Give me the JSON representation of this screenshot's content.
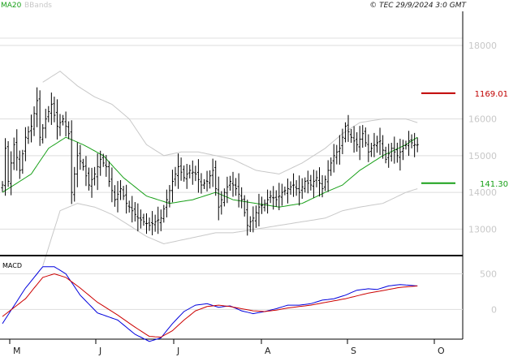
{
  "header": {
    "legend_ma": "MA20",
    "legend_bb": "BBands",
    "copyright": "© TEC 29/9/2024 3:0 GMT",
    "colors": {
      "ma": "#18a018",
      "bb": "#c8c8c8",
      "price": "#000000"
    }
  },
  "markers": {
    "resistance": {
      "label": "1169.01",
      "value": 16700,
      "color": "#c00000"
    },
    "support": {
      "label": "141.30",
      "value": 14250,
      "color": "#18a018"
    }
  },
  "macd_panel": {
    "label": "MACD"
  },
  "chart_data": [
    {
      "type": "ohlc",
      "title": "",
      "x_months": [
        "M",
        "J",
        "J",
        "A",
        "S",
        "O"
      ],
      "yticks": [
        13000,
        14000,
        15000,
        16000,
        18000
      ],
      "ylim": [
        12300,
        19000
      ],
      "n_bars": 145,
      "price_anchors": [
        [
          0,
          14200
        ],
        [
          1,
          15200
        ],
        [
          2,
          14300
        ],
        [
          4,
          15300
        ],
        [
          6,
          14600
        ],
        [
          8,
          15500
        ],
        [
          10,
          15800
        ],
        [
          12,
          16500
        ],
        [
          13,
          15500
        ],
        [
          15,
          16000
        ],
        [
          17,
          16400
        ],
        [
          19,
          15800
        ],
        [
          21,
          16000
        ],
        [
          23,
          15600
        ],
        [
          24,
          14000
        ],
        [
          26,
          15000
        ],
        [
          28,
          14700
        ],
        [
          30,
          14200
        ],
        [
          32,
          14500
        ],
        [
          34,
          14900
        ],
        [
          36,
          14700
        ],
        [
          37,
          14300
        ],
        [
          39,
          13800
        ],
        [
          41,
          14100
        ],
        [
          43,
          13700
        ],
        [
          45,
          13500
        ],
        [
          47,
          13300
        ],
        [
          49,
          13200
        ],
        [
          51,
          13100
        ],
        [
          53,
          13200
        ],
        [
          55,
          13300
        ],
        [
          57,
          13800
        ],
        [
          59,
          14300
        ],
        [
          61,
          14700
        ],
        [
          63,
          14400
        ],
        [
          65,
          14600
        ],
        [
          67,
          14500
        ],
        [
          69,
          14200
        ],
        [
          71,
          14300
        ],
        [
          73,
          14600
        ],
        [
          75,
          13600
        ],
        [
          77,
          14000
        ],
        [
          79,
          14300
        ],
        [
          81,
          14100
        ],
        [
          83,
          13800
        ],
        [
          85,
          13100
        ],
        [
          87,
          13300
        ],
        [
          89,
          13600
        ],
        [
          91,
          13700
        ],
        [
          93,
          13900
        ],
        [
          95,
          13800
        ],
        [
          97,
          14000
        ],
        [
          99,
          14100
        ],
        [
          101,
          14200
        ],
        [
          103,
          14000
        ],
        [
          105,
          14300
        ],
        [
          107,
          14200
        ],
        [
          109,
          14400
        ],
        [
          111,
          14100
        ],
        [
          113,
          14600
        ],
        [
          115,
          15000
        ],
        [
          117,
          15200
        ],
        [
          119,
          15800
        ],
        [
          121,
          15500
        ],
        [
          123,
          15300
        ],
        [
          125,
          15600
        ],
        [
          127,
          15100
        ],
        [
          129,
          15300
        ],
        [
          131,
          15400
        ],
        [
          133,
          14900
        ],
        [
          135,
          15200
        ],
        [
          137,
          15000
        ],
        [
          139,
          15200
        ],
        [
          141,
          15400
        ],
        [
          143,
          15300
        ],
        [
          144,
          15300
        ]
      ],
      "ma20_anchors": [
        [
          0,
          14000
        ],
        [
          10,
          14500
        ],
        [
          16,
          15200
        ],
        [
          22,
          15500
        ],
        [
          28,
          15300
        ],
        [
          35,
          15000
        ],
        [
          42,
          14400
        ],
        [
          50,
          13900
        ],
        [
          58,
          13700
        ],
        [
          66,
          13800
        ],
        [
          74,
          14000
        ],
        [
          80,
          13800
        ],
        [
          88,
          13700
        ],
        [
          96,
          13600
        ],
        [
          104,
          13700
        ],
        [
          112,
          14000
        ],
        [
          118,
          14200
        ],
        [
          124,
          14600
        ],
        [
          132,
          15000
        ],
        [
          140,
          15300
        ],
        [
          144,
          15500
        ]
      ],
      "bb_upper_anchors": [
        [
          14,
          17000
        ],
        [
          20,
          17300
        ],
        [
          26,
          16900
        ],
        [
          32,
          16600
        ],
        [
          38,
          16400
        ],
        [
          44,
          16000
        ],
        [
          50,
          15300
        ],
        [
          56,
          15000
        ],
        [
          62,
          15100
        ],
        [
          68,
          15100
        ],
        [
          74,
          15000
        ],
        [
          80,
          14900
        ],
        [
          88,
          14600
        ],
        [
          96,
          14500
        ],
        [
          104,
          14800
        ],
        [
          112,
          15200
        ],
        [
          118,
          15600
        ],
        [
          124,
          15900
        ],
        [
          132,
          16000
        ],
        [
          140,
          16000
        ],
        [
          144,
          15900
        ]
      ],
      "bb_lower_anchors": [
        [
          14,
          12000
        ],
        [
          20,
          13500
        ],
        [
          26,
          13700
        ],
        [
          32,
          13600
        ],
        [
          38,
          13400
        ],
        [
          44,
          13100
        ],
        [
          50,
          12800
        ],
        [
          56,
          12600
        ],
        [
          62,
          12700
        ],
        [
          68,
          12800
        ],
        [
          74,
          12900
        ],
        [
          80,
          12900
        ],
        [
          88,
          13000
        ],
        [
          96,
          13100
        ],
        [
          104,
          13200
        ],
        [
          112,
          13300
        ],
        [
          118,
          13500
        ],
        [
          124,
          13600
        ],
        [
          132,
          13700
        ],
        [
          140,
          14000
        ],
        [
          144,
          14100
        ]
      ]
    },
    {
      "type": "line",
      "title": "MACD",
      "yticks": [
        0,
        500
      ],
      "ylim": [
        -350,
        700
      ],
      "macd_anchors": [
        [
          0,
          -200
        ],
        [
          8,
          300
        ],
        [
          14,
          600
        ],
        [
          18,
          600
        ],
        [
          22,
          500
        ],
        [
          27,
          200
        ],
        [
          33,
          -50
        ],
        [
          40,
          -150
        ],
        [
          46,
          -350
        ],
        [
          51,
          -450
        ],
        [
          55,
          -400
        ],
        [
          59,
          -200
        ],
        [
          63,
          -30
        ],
        [
          67,
          60
        ],
        [
          71,
          80
        ],
        [
          75,
          30
        ],
        [
          79,
          50
        ],
        [
          83,
          -20
        ],
        [
          87,
          -60
        ],
        [
          91,
          -30
        ],
        [
          95,
          10
        ],
        [
          99,
          60
        ],
        [
          103,
          60
        ],
        [
          107,
          80
        ],
        [
          111,
          130
        ],
        [
          115,
          150
        ],
        [
          119,
          200
        ],
        [
          123,
          270
        ],
        [
          127,
          290
        ],
        [
          130,
          280
        ],
        [
          134,
          330
        ],
        [
          138,
          350
        ],
        [
          144,
          330
        ]
      ],
      "signal_anchors": [
        [
          0,
          -100
        ],
        [
          8,
          150
        ],
        [
          14,
          450
        ],
        [
          18,
          500
        ],
        [
          22,
          450
        ],
        [
          27,
          300
        ],
        [
          33,
          100
        ],
        [
          40,
          -80
        ],
        [
          46,
          -250
        ],
        [
          51,
          -380
        ],
        [
          55,
          -390
        ],
        [
          59,
          -300
        ],
        [
          63,
          -150
        ],
        [
          67,
          -20
        ],
        [
          71,
          40
        ],
        [
          75,
          60
        ],
        [
          79,
          40
        ],
        [
          83,
          10
        ],
        [
          87,
          -20
        ],
        [
          91,
          -30
        ],
        [
          95,
          -10
        ],
        [
          99,
          20
        ],
        [
          103,
          40
        ],
        [
          107,
          60
        ],
        [
          111,
          90
        ],
        [
          115,
          120
        ],
        [
          119,
          150
        ],
        [
          123,
          190
        ],
        [
          127,
          230
        ],
        [
          130,
          250
        ],
        [
          134,
          280
        ],
        [
          138,
          310
        ],
        [
          144,
          330
        ]
      ],
      "colors": {
        "macd": "#0000dd",
        "signal": "#cc0000"
      }
    }
  ]
}
